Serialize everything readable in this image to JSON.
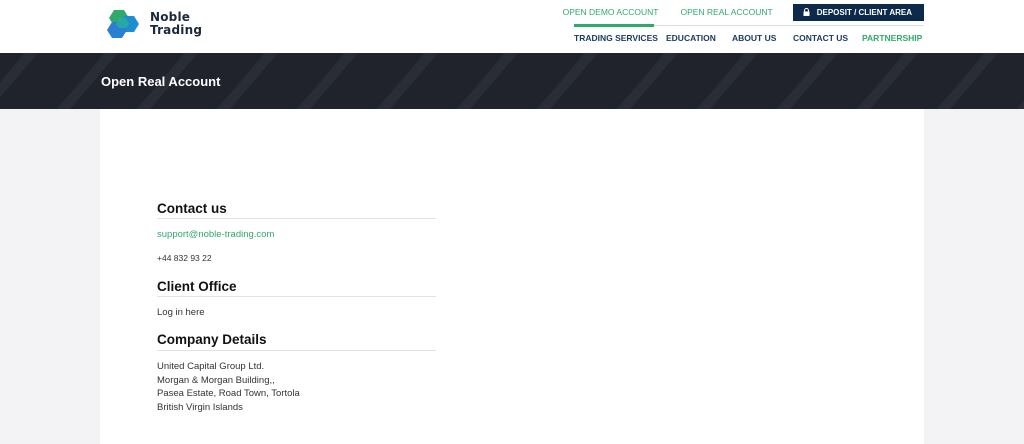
{
  "brand": {
    "line1": "Noble",
    "line2": "Trading",
    "colors": {
      "green": "#2faa6c",
      "navy": "#0e2a4a",
      "blue": "#2a7fd0"
    }
  },
  "top_links": {
    "demo": "OPEN DEMO ACCOUNT",
    "real": "OPEN REAL ACCOUNT",
    "deposit": "DEPOSIT / CLIENT AREA"
  },
  "nav": {
    "trading_services": "TRADING SERVICES",
    "education": "EDUCATION",
    "about_us": "ABOUT US",
    "contact_us": "CONTACT US",
    "partnership": "PARTNERSHIP"
  },
  "banner": {
    "title": "Open Real Account"
  },
  "contact": {
    "title": "Contact us",
    "email": "support@noble-trading.com",
    "phone": "+44 832 93 22"
  },
  "client_office": {
    "title": "Client Office",
    "login": "Log in here"
  },
  "company": {
    "title": "Company Details",
    "line1": "United Capital Group Ltd.",
    "line2": "Morgan & Morgan Building,,",
    "line3": "Pasea Estate, Road Town, Tortola",
    "line4": "British Virgin Islands"
  }
}
